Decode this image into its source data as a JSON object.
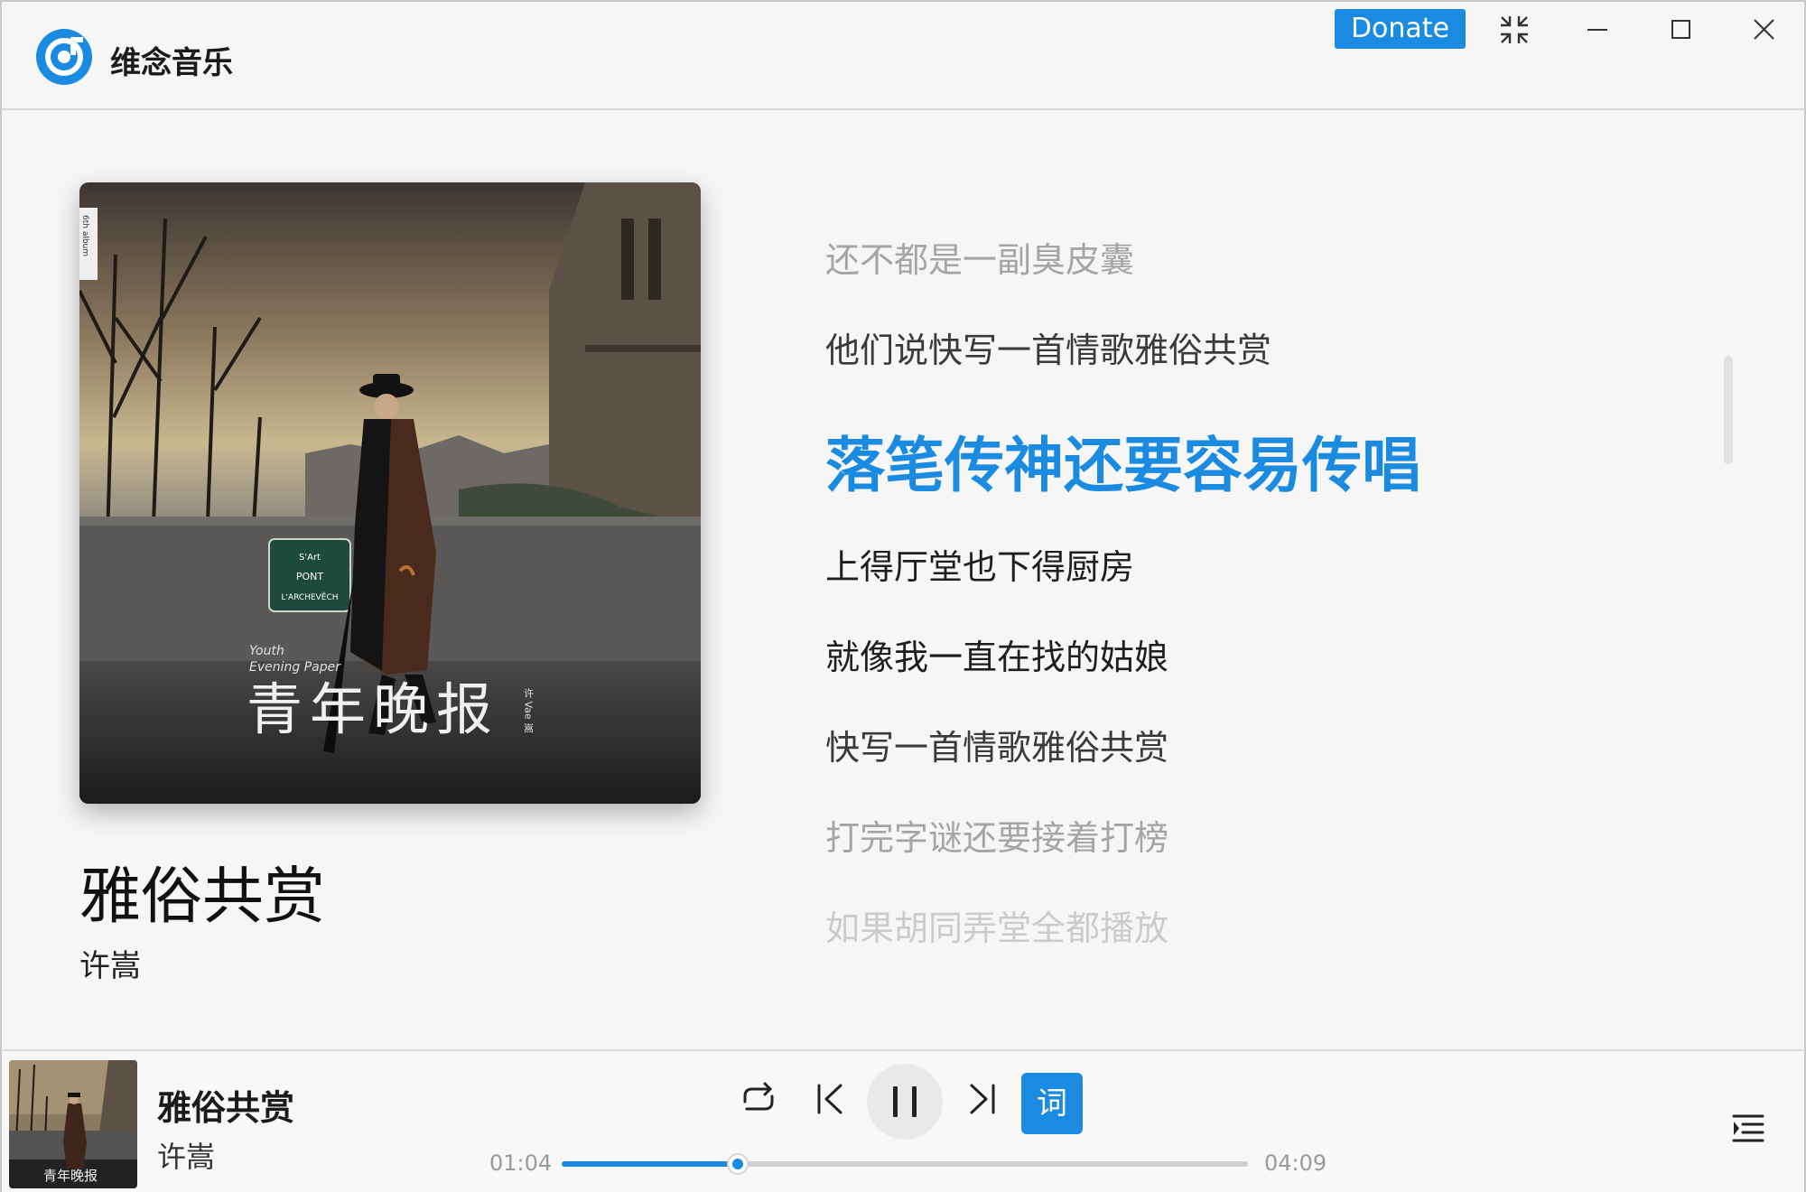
{
  "app": {
    "title": "维念音乐",
    "donate_label": "Donate",
    "accent_color": "#1a8be0",
    "icons": [
      "app-logo-icon",
      "collapse-icon",
      "minimize-icon",
      "maximize-icon",
      "close-icon"
    ]
  },
  "now_playing": {
    "title": "雅俗共赏",
    "artist": "许嵩",
    "album_cover_text": {
      "badge": "6th album",
      "sign_top": "S'Art",
      "sign_name": "PONT",
      "sign_sub": "L'ARCHEVÊCH",
      "subtitle_en_1": "Youth",
      "subtitle_en_2": "Evening Paper",
      "album_title": "青年晚报",
      "artist_vertical": "许 Vae 嵩"
    }
  },
  "lyrics": {
    "lines": [
      {
        "text": "还不都是一副臭皮囊",
        "state": "far"
      },
      {
        "text": "他们说快写一首情歌雅俗共赏",
        "state": "near"
      },
      {
        "text": "落笔传神还要容易传唱",
        "state": "current"
      },
      {
        "text": "上得厅堂也下得厨房",
        "state": "next"
      },
      {
        "text": "就像我一直在找的姑娘",
        "state": "next"
      },
      {
        "text": "快写一首情歌雅俗共赏",
        "state": "near"
      },
      {
        "text": "打完字谜还要接着打榜",
        "state": "far"
      },
      {
        "text": "如果胡同弄堂全都播放",
        "state": "fade"
      }
    ]
  },
  "player": {
    "title": "雅俗共赏",
    "artist": "许嵩",
    "current_time": "01:04",
    "total_time": "04:09",
    "progress_fraction": 0.257,
    "lyric_toggle_label": "词",
    "icons": [
      "repeat-icon",
      "previous-icon",
      "pause-icon",
      "next-icon",
      "playlist-icon"
    ]
  }
}
